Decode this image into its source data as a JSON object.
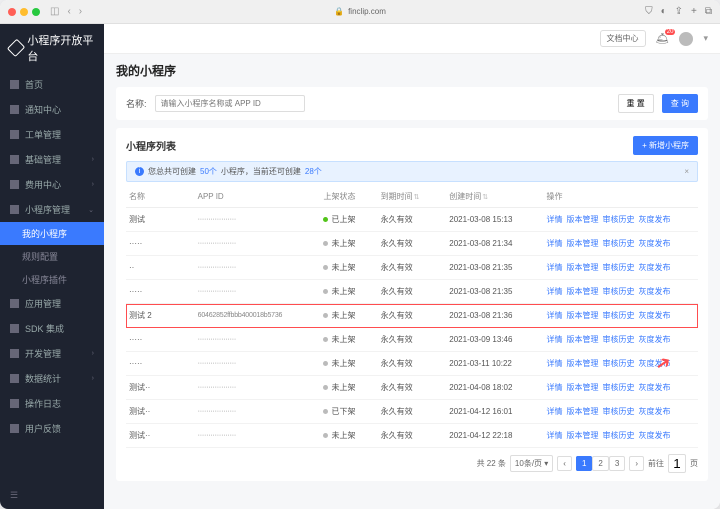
{
  "browser": {
    "url": "finclip.com",
    "lock_icon": "lock-icon"
  },
  "brand": "小程序开放平台",
  "topbar": {
    "doc_center": "文档中心",
    "notif_count": "20"
  },
  "sidebar": {
    "items": [
      {
        "label": "首页",
        "icon": true
      },
      {
        "label": "通知中心",
        "icon": true
      },
      {
        "label": "工单管理",
        "icon": true
      },
      {
        "label": "基础管理",
        "icon": true,
        "expandable": true
      },
      {
        "label": "费用中心",
        "icon": true,
        "expandable": true
      },
      {
        "label": "小程序管理",
        "icon": true,
        "expandable": true,
        "expanded": true,
        "children": [
          {
            "label": "我的小程序",
            "active": true
          },
          {
            "label": "规则配置"
          },
          {
            "label": "小程序插件"
          }
        ]
      },
      {
        "label": "应用管理",
        "icon": true
      },
      {
        "label": "SDK 集成",
        "icon": true
      },
      {
        "label": "开发管理",
        "icon": true,
        "expandable": true
      },
      {
        "label": "数据统计",
        "icon": true,
        "expandable": true
      },
      {
        "label": "操作日志",
        "icon": true
      },
      {
        "label": "用户反馈",
        "icon": true
      }
    ]
  },
  "page": {
    "title": "我的小程序",
    "search_label": "名称:",
    "search_placeholder": "请输入小程序名称或 APP ID",
    "reset_btn": "重 置",
    "query_btn": "查 询"
  },
  "table": {
    "title": "小程序列表",
    "add_btn": "+ 新增小程序",
    "alert_prefix": "您总共可创建",
    "alert_total": "50个",
    "alert_mid": "小程序，当前还可创建",
    "alert_remain": "28个",
    "columns": {
      "name": "名称",
      "appid": "APP ID",
      "status": "上架状态",
      "expire": "到期时间",
      "created": "创建时间",
      "ops": "操作"
    },
    "rows": [
      {
        "name": "测试",
        "appid": "··················",
        "status": "已上架",
        "status_color": "green",
        "expire": "永久有效",
        "created": "2021-03-08 15:13"
      },
      {
        "name": "·····",
        "appid": "··················",
        "status": "未上架",
        "status_color": "gray",
        "expire": "永久有效",
        "created": "2021-03-08 21:34"
      },
      {
        "name": "··",
        "appid": "··················",
        "status": "未上架",
        "status_color": "gray",
        "expire": "永久有效",
        "created": "2021-03-08 21:35"
      },
      {
        "name": "·····",
        "appid": "··················",
        "status": "未上架",
        "status_color": "gray",
        "expire": "永久有效",
        "created": "2021-03-08 21:35"
      },
      {
        "name": "测试 2",
        "appid": "60462852ffbbb400018b5736",
        "status": "未上架",
        "status_color": "gray",
        "expire": "永久有效",
        "created": "2021-03-08 21:36",
        "highlight": true
      },
      {
        "name": "·····",
        "appid": "··················",
        "status": "未上架",
        "status_color": "gray",
        "expire": "永久有效",
        "created": "2021-03-09 13:46"
      },
      {
        "name": "·····",
        "appid": "··················",
        "status": "未上架",
        "status_color": "gray",
        "expire": "永久有效",
        "created": "2021-03-11 10:22"
      },
      {
        "name": "测试··",
        "appid": "··················",
        "status": "未上架",
        "status_color": "gray",
        "expire": "永久有效",
        "created": "2021-04-08 18:02"
      },
      {
        "name": "测试··",
        "appid": "··················",
        "status": "已下架",
        "status_color": "gray",
        "expire": "永久有效",
        "created": "2021-04-12 16:01"
      },
      {
        "name": "测试··",
        "appid": "··················",
        "status": "未上架",
        "status_color": "gray",
        "expire": "永久有效",
        "created": "2021-04-12 22:18"
      }
    ],
    "action_labels": {
      "detail": "详情",
      "version": "版本管理",
      "audit": "审核历史",
      "gray": "灰度发布"
    }
  },
  "pagination": {
    "total_label": "共 22 条",
    "page_size": "10条/页",
    "pages": [
      "1",
      "2",
      "3"
    ],
    "active": "1",
    "goto_label": "前往",
    "goto_value": "1",
    "goto_suffix": "页"
  }
}
